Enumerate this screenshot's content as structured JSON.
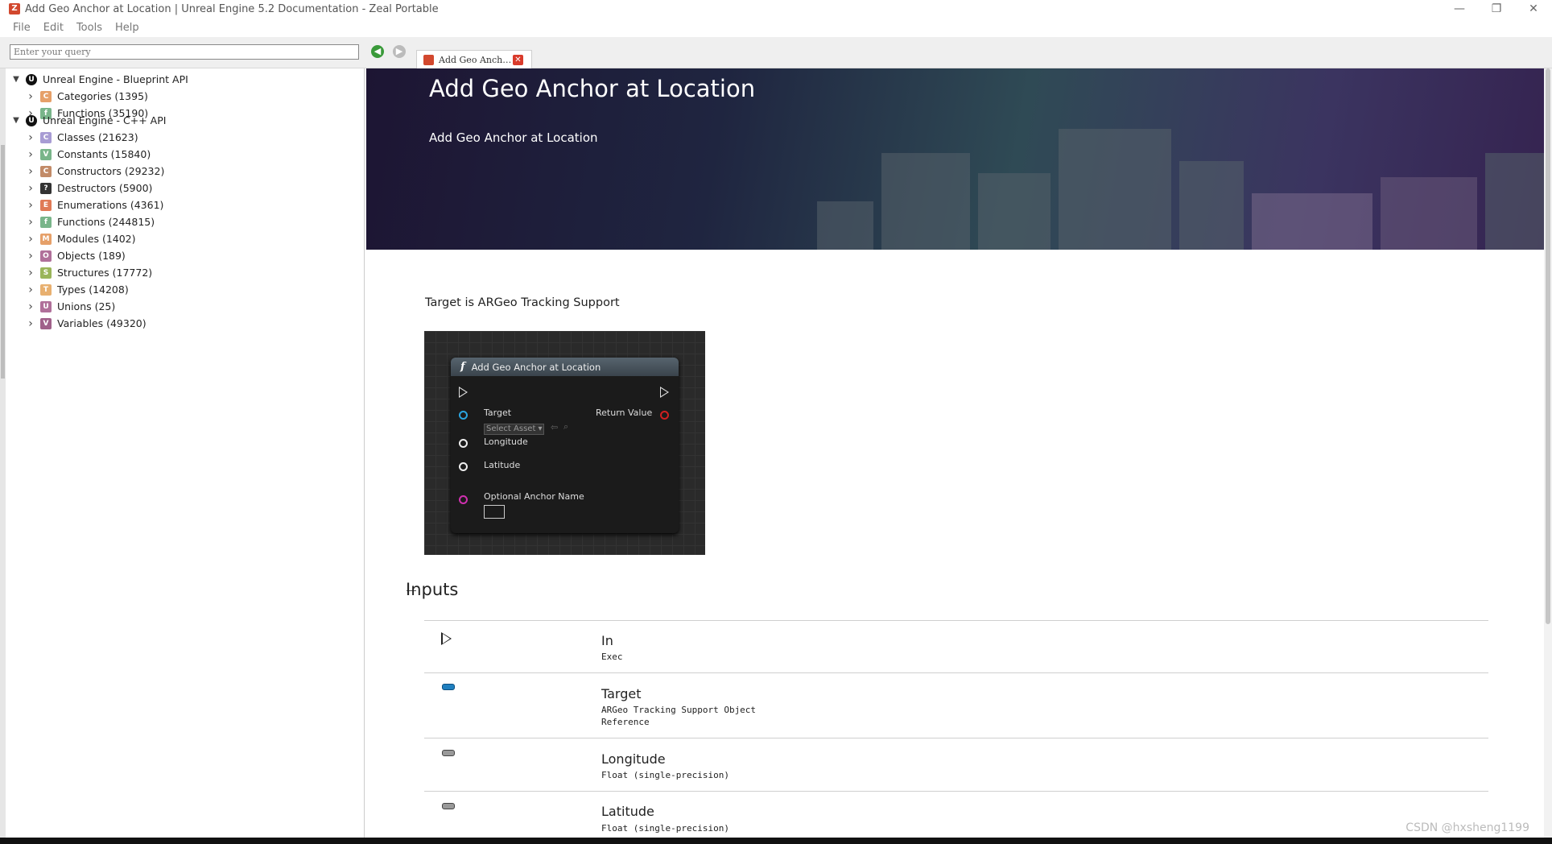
{
  "window": {
    "title": "Add Geo Anchor at Location | Unreal Engine 5.2 Documentation - Zeal Portable",
    "controls": [
      "—",
      "❐",
      "✕"
    ]
  },
  "menu": [
    "File",
    "Edit",
    "Tools",
    "Help"
  ],
  "search": {
    "placeholder": "Enter your query"
  },
  "tab": {
    "label": "Add Geo Anch…"
  },
  "tree": {
    "blueprint": {
      "label": "Unreal Engine - Blueprint API",
      "items": [
        {
          "icon": "C",
          "label": "Categories (1395)",
          "color": "#e6a069"
        },
        {
          "icon": "f",
          "label": "Functions (35190)",
          "color": "#79b58a"
        }
      ]
    },
    "cpp": {
      "label": "Unreal Engine - C++ API",
      "items": [
        {
          "icon": "C",
          "label": "Classes (21623)",
          "color": "#a89cd4"
        },
        {
          "icon": "V",
          "label": "Constants (15840)",
          "color": "#79b58a"
        },
        {
          "icon": "C",
          "label": "Constructors (29232)",
          "color": "#c28b68"
        },
        {
          "icon": "?",
          "label": "Destructors (5900)",
          "color": "#333333"
        },
        {
          "icon": "E",
          "label": "Enumerations (4361)",
          "color": "#e07a56"
        },
        {
          "icon": "f",
          "label": "Functions (244815)",
          "color": "#79b58a"
        },
        {
          "icon": "M",
          "label": "Modules (1402)",
          "color": "#e6a069"
        },
        {
          "icon": "O",
          "label": "Objects (189)",
          "color": "#b0709a"
        },
        {
          "icon": "S",
          "label": "Structures (17772)",
          "color": "#9ab55a"
        },
        {
          "icon": "T",
          "label": "Types (14208)",
          "color": "#e8b070"
        },
        {
          "icon": "U",
          "label": "Unions (25)",
          "color": "#b0709a"
        },
        {
          "icon": "V",
          "label": "Variables (49320)",
          "color": "#a0608a"
        }
      ]
    }
  },
  "hero": {
    "title": "Add Geo Anchor at Location",
    "subtitle": "Add Geo Anchor at Location"
  },
  "target_line": "Target is ARGeo Tracking Support",
  "node": {
    "title": "Add Geo Anchor at Location",
    "target_label": "Target",
    "select_asset": "Select Asset",
    "return_label": "Return Value",
    "longitude_label": "Longitude",
    "latitude_label": "Latitude",
    "anchor_label": "Optional Anchor Name"
  },
  "inputs": {
    "heading": "Inputs",
    "rows": [
      {
        "name": "In",
        "type": "Exec"
      },
      {
        "name": "Target",
        "type": "ARGeo Tracking Support Object Reference",
        "color": "#1f7fbf"
      },
      {
        "name": "Longitude",
        "type": "Float (single-precision)",
        "color": "#888888"
      },
      {
        "name": "Latitude",
        "type": "Float (single-precision)",
        "color": "#888888"
      }
    ]
  },
  "watermark": "CSDN @hxsheng1199"
}
